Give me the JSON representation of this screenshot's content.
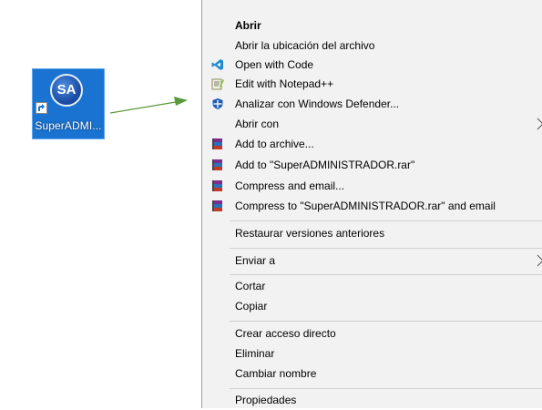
{
  "desktop": {
    "shortcut": {
      "logo_text": "SA",
      "label": "SuperADMI...",
      "icon": "superadministrador-logo-icon"
    }
  },
  "colors": {
    "icon_selected_bg": "#1a73d0",
    "menu_bg": "#f2f2f2",
    "annotation_arrow": "#5a9a3a"
  },
  "context_menu": {
    "items": [
      {
        "label": "Abrir",
        "bold": true,
        "icon": null
      },
      {
        "label": "Abrir la ubicación del archivo",
        "icon": null
      },
      {
        "label": "Open with Code",
        "icon": "vscode-icon"
      },
      {
        "label": "Edit with Notepad++",
        "icon": "notepadplusplus-icon"
      },
      {
        "label": "Analizar con Windows Defender...",
        "icon": "windows-defender-icon"
      },
      {
        "label": "Abrir con",
        "icon": null,
        "submenu": true
      },
      {
        "label": "Add to archive...",
        "icon": "winrar-icon"
      },
      {
        "label": "Add to \"SuperADMINISTRADOR.rar\"",
        "icon": "winrar-icon"
      },
      {
        "label": "Compress and email...",
        "icon": "winrar-icon"
      },
      {
        "label": "Compress to \"SuperADMINISTRADOR.rar\" and email",
        "icon": "winrar-icon"
      },
      {
        "label": "Restaurar versiones anteriores",
        "icon": null
      },
      {
        "label": "Enviar a",
        "icon": null,
        "submenu": true
      },
      {
        "label": "Cortar",
        "icon": null
      },
      {
        "label": "Copiar",
        "icon": null
      },
      {
        "label": "Crear acceso directo",
        "icon": null
      },
      {
        "label": "Eliminar",
        "icon": null
      },
      {
        "label": "Cambiar nombre",
        "icon": null
      },
      {
        "label": "Propiedades",
        "icon": null
      }
    ]
  }
}
